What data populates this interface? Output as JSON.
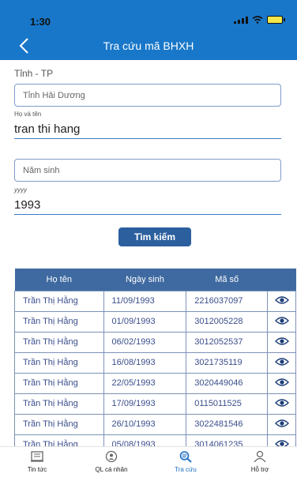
{
  "status": {
    "time": "1:30"
  },
  "nav": {
    "title": "Tra cứu mã BHXH"
  },
  "form": {
    "province_label": "Tỉnh - TP",
    "province_value": "Tỉnh Hải Dương",
    "name_label": "Họ và tên",
    "name_value": "tran thi hang",
    "birth_year_placeholder": "Năm sinh",
    "birth_year_label": "yyyy",
    "birth_year_value": "1993",
    "search_button": "Tìm kiếm"
  },
  "table": {
    "headers": [
      "Họ tên",
      "Ngày sinh",
      "Mã số"
    ],
    "rows": [
      {
        "name": "Trần Thị Hằng",
        "dob": "11/09/1993",
        "code": "2216037097"
      },
      {
        "name": "Trần Thị Hằng",
        "dob": "01/09/1993",
        "code": "3012005228"
      },
      {
        "name": "Trần Thị Hằng",
        "dob": "06/02/1993",
        "code": "3012052537"
      },
      {
        "name": "Trần Thị Hằng",
        "dob": "16/08/1993",
        "code": "3021735119"
      },
      {
        "name": "Trần Thị Hằng",
        "dob": "22/05/1993",
        "code": "3020449046"
      },
      {
        "name": "Trần Thị Hằng",
        "dob": "17/09/1993",
        "code": "0115011525"
      },
      {
        "name": "Trần Thị Hằng",
        "dob": "26/10/1993",
        "code": "3022481546"
      },
      {
        "name": "Trần Thị Hằng",
        "dob": "05/08/1993",
        "code": "3014061235"
      }
    ]
  },
  "tabs": [
    {
      "label": "Tin tức",
      "icon": "newspaper-icon"
    },
    {
      "label": "QL cá nhân",
      "icon": "profile-badge-icon"
    },
    {
      "label": "Tra cứu",
      "icon": "search-document-icon",
      "active": true
    },
    {
      "label": "Hỗ trợ",
      "icon": "support-person-icon"
    }
  ],
  "colors": {
    "header": "#1877c9",
    "table_header": "#3f6aa1",
    "button": "#2c5f9e",
    "active_tab": "#1f6fc2"
  }
}
